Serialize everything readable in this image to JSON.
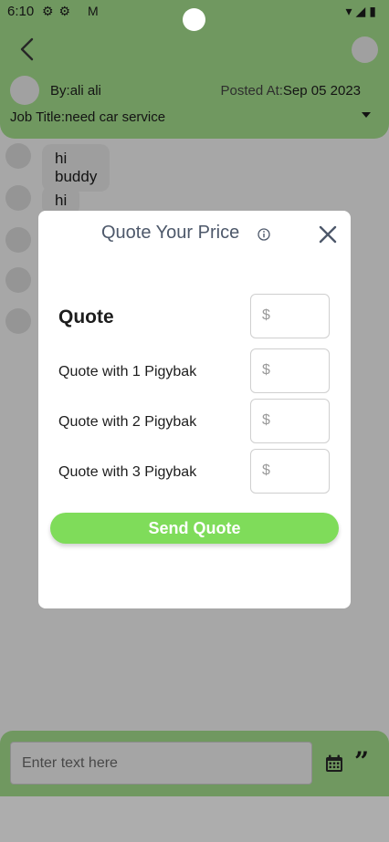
{
  "status_bar": {
    "time": "6:10"
  },
  "header": {
    "by_label": "By:",
    "by_name": "ali ali",
    "posted_label": "Posted At:",
    "posted_date": "Sep 05 2023",
    "job_label": "Job Title:",
    "job_title": "need car service"
  },
  "messages": [
    {
      "text": "hi buddy"
    },
    {
      "text": "hi"
    }
  ],
  "composer": {
    "placeholder": "Enter text here"
  },
  "modal": {
    "title": "Quote Your Price",
    "rows": [
      {
        "label": "Quote",
        "currency": "$"
      },
      {
        "label": "Quote with 1 Pigybak",
        "currency": "$"
      },
      {
        "label": "Quote with 2 Pigybak",
        "currency": "$"
      },
      {
        "label": "Quote with 3 Pigybak",
        "currency": "$"
      }
    ],
    "submit_label": "Send Quote"
  },
  "colors": {
    "header_green": "#a6e08e",
    "button_green": "#7fdc5a",
    "title_text": "#4d586a"
  }
}
